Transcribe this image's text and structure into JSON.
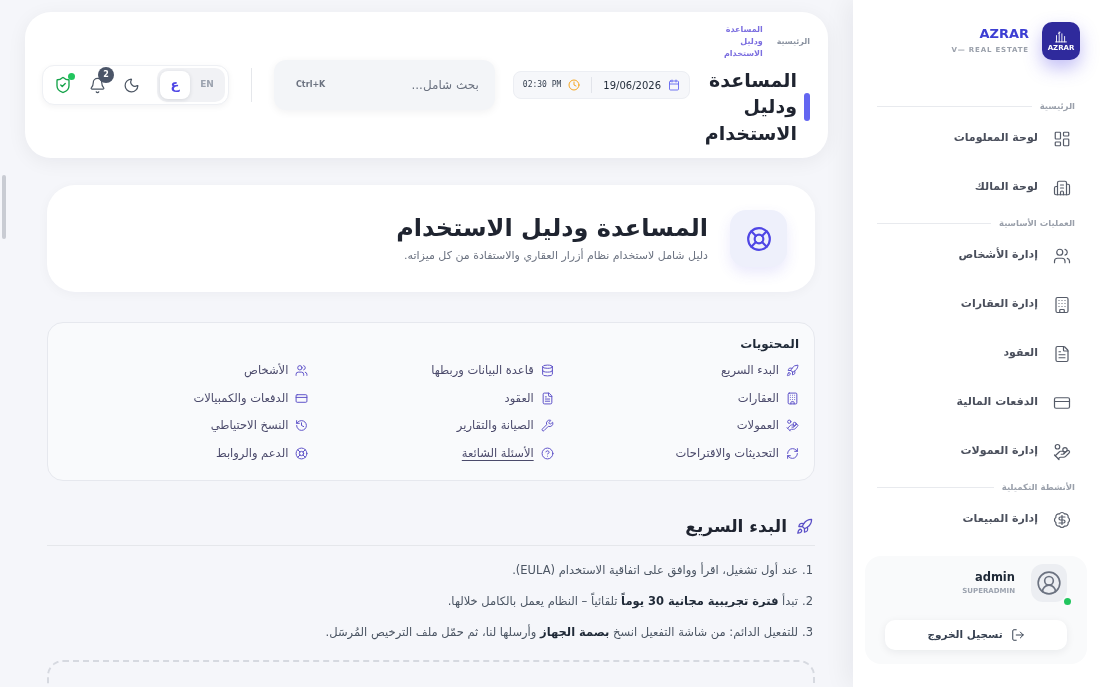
{
  "sidebar": {
    "brand": {
      "logo_text": "AZRAR",
      "name": "AZRAR",
      "tagline": "V— REAL ESTATE"
    },
    "sections": [
      {
        "title": "الرئيسية",
        "items": [
          {
            "label": "لوحة المعلومات"
          },
          {
            "label": "لوحة المالك"
          }
        ]
      },
      {
        "title": "العمليات الأساسية",
        "items": [
          {
            "label": "إدارة الأشخاص"
          },
          {
            "label": "إدارة العقارات"
          },
          {
            "label": "العقود"
          },
          {
            "label": "الدفعات المالية"
          },
          {
            "label": "إدارة العمولات"
          }
        ]
      },
      {
        "title": "الأنشطة التكميلية",
        "items": [
          {
            "label": "إدارة المبيعات"
          }
        ]
      }
    ],
    "user": {
      "name": "admin",
      "role": "SUPERADMIN",
      "online": true
    },
    "logout_button": "تسجيل الخروج"
  },
  "header": {
    "breadcrumb": [
      {
        "label": "الرئيسية",
        "current": false
      },
      {
        "label": "المساعدة ودليل الاستخدام",
        "current": true
      }
    ],
    "title": "المساعدة ودليل الاستخدام",
    "date": "19/06/2026",
    "time": "02:30 PM",
    "search": {
      "placeholder": "بحث شامل...",
      "shortcut": "Ctrl+K"
    },
    "languages": [
      {
        "label": "EN",
        "selected": false
      },
      {
        "label": "ع",
        "selected": true
      }
    ],
    "notifications": {
      "count": "2"
    },
    "security": {
      "active": true
    }
  },
  "hero": {
    "title": "المساعدة ودليل الاستخدام",
    "subtitle": "دليل شامل لاستخدام نظام أزرار العقاري والاستفادة من كل ميزاته."
  },
  "contents": {
    "title": "المحتويات",
    "items": [
      {
        "label": "البدء السريع",
        "hovered": false
      },
      {
        "label": "قاعدة البيانات وربطها",
        "hovered": false
      },
      {
        "label": "الأشخاص",
        "hovered": false
      },
      {
        "label": "العقارات",
        "hovered": false
      },
      {
        "label": "العقود",
        "hovered": false
      },
      {
        "label": "الدفعات والكمبيالات",
        "hovered": false
      },
      {
        "label": "العمولات",
        "hovered": false
      },
      {
        "label": "الصيانة والتقارير",
        "hovered": false
      },
      {
        "label": "النسخ الاحتياطي",
        "hovered": false
      },
      {
        "label": "التحديثات والاقتراحات",
        "hovered": false
      },
      {
        "label": "الأسئلة الشائعة",
        "hovered": true
      },
      {
        "label": "الدعم والروابط",
        "hovered": false
      }
    ]
  },
  "quick_start": {
    "title": "البدء السريع",
    "steps": [
      {
        "number": "1.",
        "text": "عند أول تشغيل، اقرأ ووافق على اتفاقية الاستخدام (EULA)."
      },
      {
        "number": "2.",
        "text": "تبدأ **فترة تجريبية مجانية 30 يوماً** تلقائياً – النظام يعمل بالكامل خلالها."
      },
      {
        "number": "3.",
        "text": "للتفعيل الدائم: من شاشة التفعيل انسخ **بصمة الجهاز** وأرسلها لنا، ثم حمّل ملف الترخيص المُرسَل."
      }
    ]
  }
}
